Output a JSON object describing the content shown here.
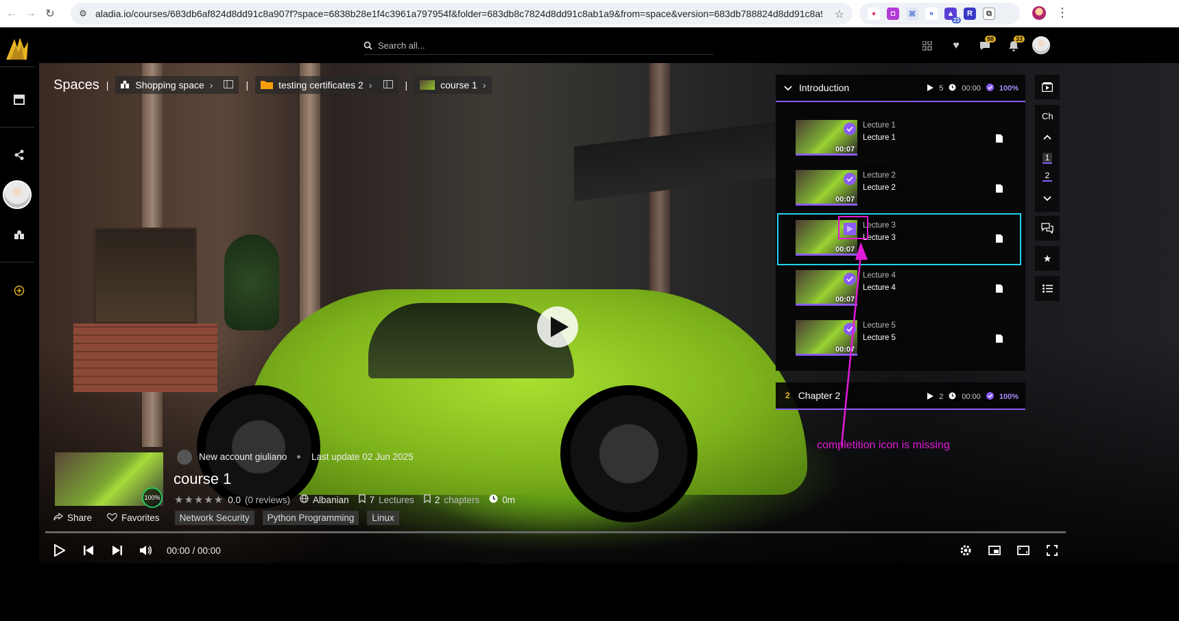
{
  "browser": {
    "url": "aladia.io/courses/683db6af824d8dd91c8a907f?space=6838b28e1f4c3961a797954f&folder=683db8c7824d8dd91c8ab1a9&from=space&version=683db788824d8dd91c8a9...",
    "extension_badge": "23"
  },
  "topbar": {
    "search_placeholder": "Search all...",
    "favorites_count": "98",
    "notifications_count": "33"
  },
  "breadcrumb": {
    "title": "Spaces",
    "space": "Shopping space",
    "folder": "testing certificates 2",
    "course": "course 1"
  },
  "playlist": {
    "section_title": "Introduction",
    "section_lectures": "5",
    "section_time": "00:00",
    "section_progress": "100%",
    "lectures": [
      {
        "title": "Lecture 1",
        "subtitle": "Lecture 1",
        "duration": "00:07",
        "status": "completed"
      },
      {
        "title": "Lecture 2",
        "subtitle": "Lecture 2",
        "duration": "00:07",
        "status": "completed"
      },
      {
        "title": "Lecture 3",
        "subtitle": "Lecture 3",
        "duration": "00:07",
        "status": "playing"
      },
      {
        "title": "Lecture 4",
        "subtitle": "Lecture 4",
        "duration": "00:07",
        "status": "completed"
      },
      {
        "title": "Lecture 5",
        "subtitle": "Lecture 5",
        "duration": "00:07",
        "status": "completed"
      }
    ],
    "chapter2": {
      "number": "2",
      "title": "Chapter 2",
      "lectures": "2",
      "time": "00:00",
      "progress": "100%"
    }
  },
  "rail": {
    "chapter_label": "Ch",
    "chapters": [
      "1",
      "2"
    ]
  },
  "annotation": {
    "text": "completition icon is missing",
    "color": "#e21bd8"
  },
  "course": {
    "progress": "100%",
    "author": "New account giuliano",
    "last_update": "Last update 02 Jun 2025",
    "title": "course 1",
    "rating": "0.0",
    "reviews": "(0 reviews)",
    "language": "Albanian",
    "lectures_count": "7",
    "lectures_label": "Lectures",
    "chapters_count": "2",
    "chapters_label": "chapters",
    "duration": "0m",
    "share_label": "Share",
    "favorites_label": "Favorites",
    "tags": [
      "Network Security",
      "Python Programming",
      "Linux"
    ]
  },
  "player": {
    "time": "00:00 / 00:00"
  },
  "colors": {
    "accent_purple": "#8b5cf6",
    "highlight_cyan": "#22d3ee",
    "badge_gold": "#e6b422"
  }
}
